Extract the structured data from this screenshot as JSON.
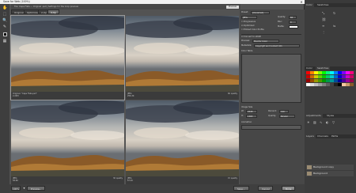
{
  "window": {
    "title": "Save for Web (100%)"
  },
  "info_bar": {
    "text": "File: Cape Flats — Original .psd  |  Settings for the 4-Up preview",
    "preview_button": "Preview"
  },
  "view_tabs": [
    "Original",
    "Optimized",
    "2-Up",
    "4-Up"
  ],
  "active_view_tab": "4-Up",
  "panes": [
    {
      "caption_left": "Original: \"Cape Flats.psd\"",
      "caption_left2": "2.24M",
      "caption_right": ""
    },
    {
      "caption_left": "JPEG",
      "caption_left2": "256.3K",
      "caption_right": "60 quality"
    },
    {
      "caption_left": "JPEG",
      "caption_left2": "94.6K",
      "caption_right": "30 quality"
    },
    {
      "caption_left": "JPEG",
      "caption_left2": "67.2K",
      "caption_right": "15 quality"
    }
  ],
  "settings": {
    "preset_label": "Preset:",
    "preset_value": "[Unnamed]",
    "format_value": "JPEG",
    "quality_label": "Quality:",
    "quality_value": "60",
    "blur_label": "Blur:",
    "blur_value": "0",
    "progressive_label": "Progressive",
    "optimized_label": "Optimized",
    "embed_profile_label": "Embed Color Profile",
    "matte_label": "Matte:",
    "convert_srgb_label": "Convert to sRGB",
    "preview_label": "Preview:",
    "preview_value": "Monitor Color",
    "metadata_label": "Metadata:",
    "metadata_value": "Copyright and Contact Info",
    "color_table_label": "Color Table",
    "image_size_label": "Image Size",
    "w_label": "W:",
    "w_value": "2048",
    "h_label": "H:",
    "h_value": "1365",
    "percent_label": "Percent:",
    "percent_value": "100",
    "quality2_label": "Quality:",
    "quality2_value": "Bicubic",
    "animation_label": "Animation"
  },
  "bottom_bar": {
    "zoom_value": "100%",
    "preview_button": "Preview...",
    "save_button": "Save...",
    "cancel_button": "Cancel",
    "done_button": "Done"
  },
  "right_panels": {
    "tabs_top": [
      "Color",
      "Swatches"
    ],
    "tabs_mid": [
      "Adjustments",
      "Styles"
    ],
    "tabs_layers": [
      "Layers",
      "Channels",
      "Paths"
    ],
    "layers": [
      {
        "name": "Background copy"
      },
      {
        "name": "Background"
      }
    ]
  },
  "colors": {
    "dialog_bg": "#535353",
    "panel_bg": "#3c3c3c",
    "title_bar": "#f2f2f2"
  }
}
